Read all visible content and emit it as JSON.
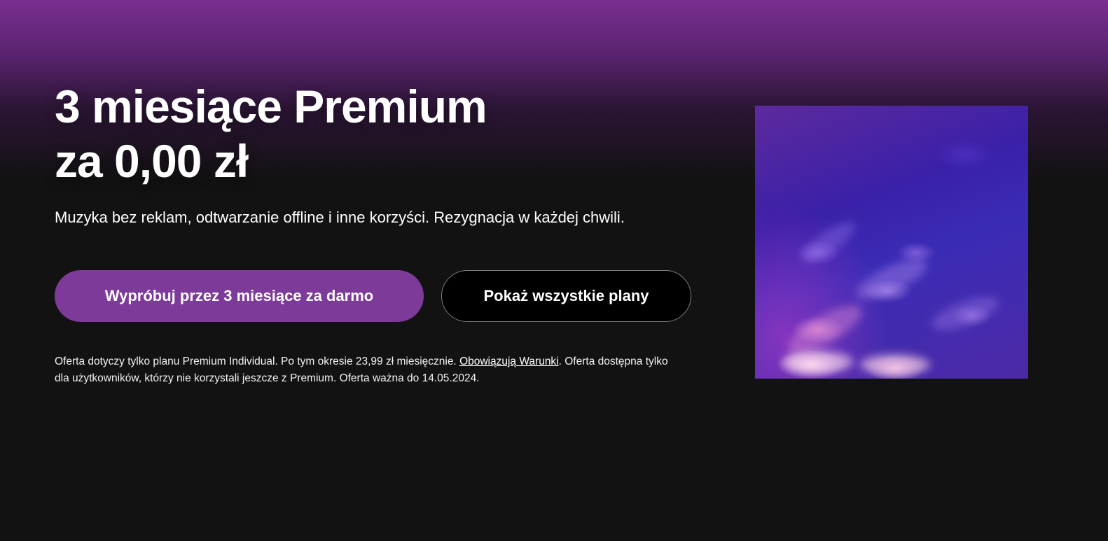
{
  "hero": {
    "title_line1": "3 miesiące Premium",
    "title_line2": "za 0,00 zł",
    "subtitle": "Muzyka bez reklam, odtwarzanie offline i inne korzyści. Rezygnacja w każdej chwili."
  },
  "buttons": {
    "primary_label": "Wypróbuj przez 3 miesiące za darmo",
    "secondary_label": "Pokaż wszystkie plany"
  },
  "fineprint": {
    "part1": "Oferta dotyczy tylko planu Premium Individual. Po tym okresie 23,99 zł miesięcznie. ",
    "terms_link": "Obowiązują Warunki",
    "part2": ". Oferta dostępna tylko dla użytkowników, którzy nie korzystali jeszcze z Premium. Oferta ważna do 14.05.2024."
  },
  "colors": {
    "accent": "#7d3a98",
    "background": "#121212",
    "gradient_top": "#7a2e90"
  }
}
